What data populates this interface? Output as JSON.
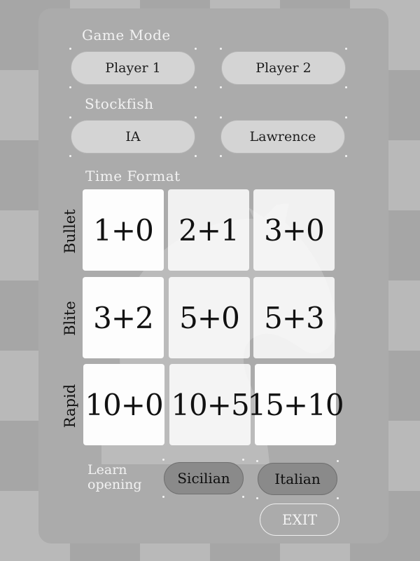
{
  "game_mode": {
    "heading": "Game Mode",
    "player1_label": "Player 1",
    "player2_label": "Player 2"
  },
  "stockfish": {
    "heading": "Stockfish",
    "ia_label": "IA",
    "lawrence_label": "Lawrence"
  },
  "time_format": {
    "heading": "Time Format",
    "rows": [
      {
        "label": "Bullet",
        "options": [
          "1+0",
          "2+1",
          "3+0"
        ]
      },
      {
        "label": "Blite",
        "options": [
          "3+2",
          "5+0",
          "5+3"
        ]
      },
      {
        "label": "Rapid",
        "options": [
          "10+0",
          "10+5",
          "15+10"
        ]
      }
    ]
  },
  "learn_opening": {
    "line1": "Learn",
    "line2": "opening",
    "sicilian_label": "Sicilian",
    "italian_label": "Italian"
  },
  "exit_label": "EXIT",
  "colors": {
    "board_light": "#b9b9b9",
    "board_dark": "#a6a6a6",
    "panel": "#ababab",
    "tile": "#fdfdfd",
    "pill": "#d4d4d4",
    "pill_dark": "#8a8a8a"
  },
  "icons": {
    "background_piece": "knight-icon"
  }
}
